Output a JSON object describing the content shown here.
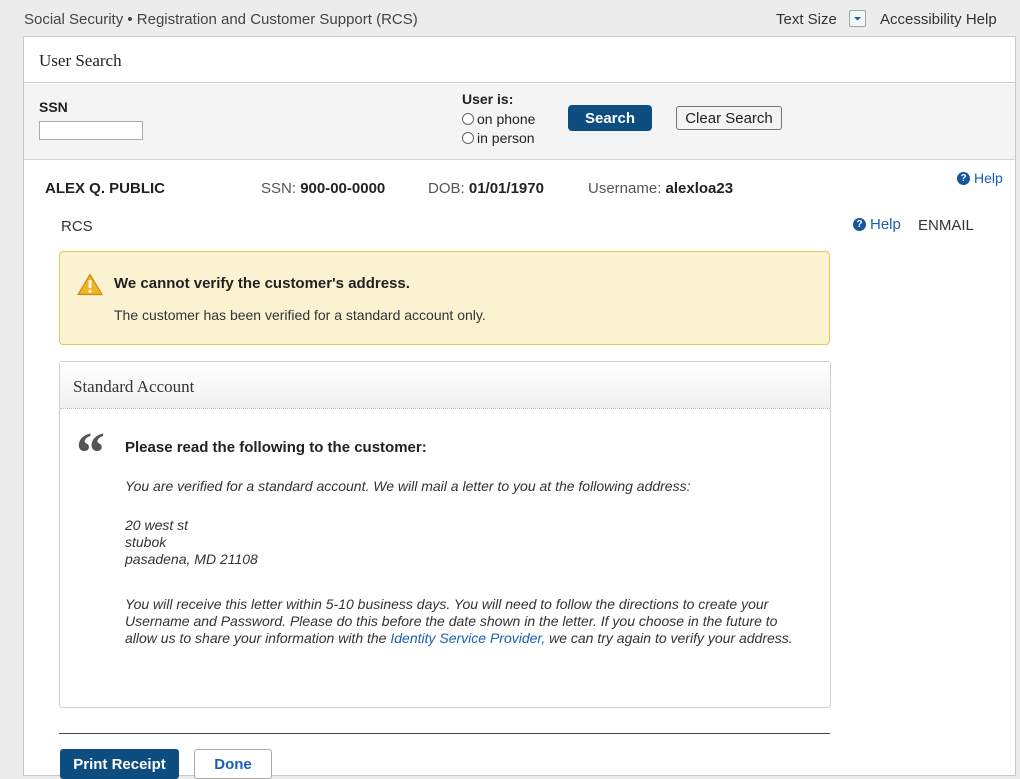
{
  "header": {
    "app_title": "Social Security • Registration and Customer Support (RCS)",
    "text_size_label": "Text Size",
    "accessibility_label": "Accessibility Help"
  },
  "user_search": {
    "title": "User Search",
    "ssn_label": "SSN",
    "ssn_value": "",
    "user_is_label": "User is:",
    "options": [
      "on phone",
      "in person"
    ],
    "search_label": "Search",
    "clear_label": "Clear Search"
  },
  "customer": {
    "name": "ALEX Q. PUBLIC",
    "ssn_label": "SSN:",
    "ssn": "900-00-0000",
    "dob_label": "DOB:",
    "dob": "01/01/1970",
    "username_label": "Username:",
    "username": "alexloa23",
    "help_label": "Help"
  },
  "section": {
    "rcs_label": "RCS",
    "help_label": "Help",
    "enmail_label": "ENMAIL"
  },
  "warning": {
    "title": "We cannot verify the customer's address.",
    "message": "The customer has been verified for a standard account only."
  },
  "standard_account": {
    "title": "Standard Account",
    "read_title": "Please read the following to the customer:",
    "line1": "You are verified for a standard account. We will mail a letter to you at the following address:",
    "address": [
      "20 west st",
      "stubok",
      "pasadena, MD 21108"
    ],
    "para_start": "You will receive this letter within 5-10 business days. You will need to follow the directions to create your Username and Password. Please do this before the date shown in the letter. If you choose in the future to allow us to share your information with the ",
    "link_text": "Identity Service Provider,",
    "para_end": " we can try again to verify your address."
  },
  "actions": {
    "print_label": "Print Receipt",
    "done_label": "Done"
  },
  "colors": {
    "primary_button": "#0d4d7f",
    "warning_bg": "#fbf2d2",
    "warning_border": "#e8c65a",
    "link": "#1a5fb4"
  }
}
